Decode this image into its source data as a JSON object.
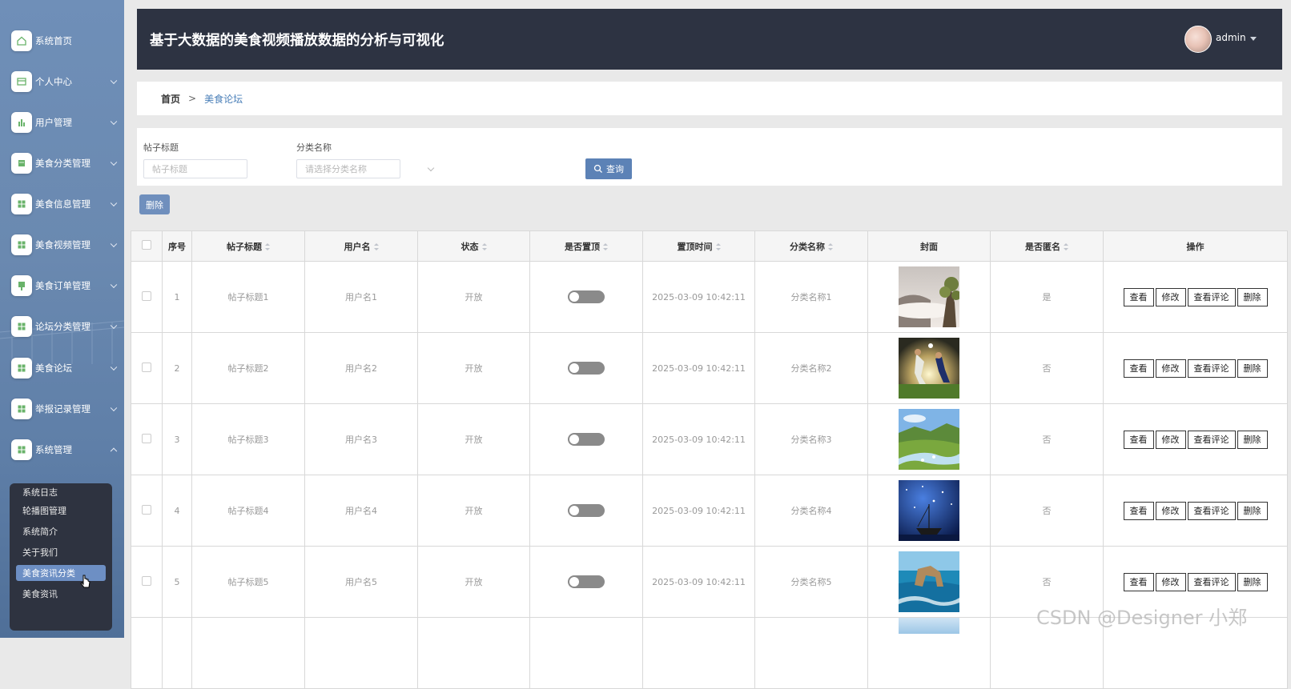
{
  "app": {
    "title": "基于大数据的美食视频播放数据的分析与可视化",
    "user": "admin"
  },
  "sidebar": {
    "items": [
      {
        "label": "系统首页",
        "icon": "home-icon"
      },
      {
        "label": "个人中心",
        "icon": "card-icon"
      },
      {
        "label": "用户管理",
        "icon": "bar-chart-icon"
      },
      {
        "label": "美食分类管理",
        "icon": "book-icon"
      },
      {
        "label": "美食信息管理",
        "icon": "grid-icon"
      },
      {
        "label": "美食视频管理",
        "icon": "grid-icon"
      },
      {
        "label": "美食订单管理",
        "icon": "pin-icon"
      },
      {
        "label": "论坛分类管理",
        "icon": "grid-icon"
      },
      {
        "label": "美食论坛",
        "icon": "grid-icon"
      },
      {
        "label": "举报记录管理",
        "icon": "grid-icon"
      },
      {
        "label": "系统管理",
        "icon": "grid-icon"
      }
    ],
    "submenu": [
      "系统日志",
      "轮播图管理",
      "系统简介",
      "关于我们",
      "美食资讯分类",
      "美食资讯"
    ],
    "submenu_active_index": 4
  },
  "breadcrumb": {
    "home": "首页",
    "separator": ">",
    "current": "美食论坛"
  },
  "search": {
    "title_label": "帖子标题",
    "title_placeholder": "帖子标题",
    "category_label": "分类名称",
    "category_placeholder": "请选择分类名称",
    "query_button": "查询"
  },
  "actions": {
    "delete_button": "删除"
  },
  "table": {
    "headers": [
      "序号",
      "帖子标题",
      "用户名",
      "状态",
      "是否置顶",
      "置顶时间",
      "分类名称",
      "封面",
      "是否匿名",
      "操作"
    ],
    "rows": [
      {
        "no": "1",
        "title": "帖子标题1",
        "user": "用户名1",
        "status": "开放",
        "time": "2025-03-09 10:42:11",
        "category": "分类名称1",
        "anon": "是",
        "cover": "misty-mountain-tree-image"
      },
      {
        "no": "2",
        "title": "帖子标题2",
        "user": "用户名2",
        "status": "开放",
        "time": "2025-03-09 10:42:11",
        "category": "分类名称2",
        "anon": "否",
        "cover": "soccer-players-image"
      },
      {
        "no": "3",
        "title": "帖子标题3",
        "user": "用户名3",
        "status": "开放",
        "time": "2025-03-09 10:42:11",
        "category": "分类名称3",
        "anon": "否",
        "cover": "green-valley-stream-image"
      },
      {
        "no": "4",
        "title": "帖子标题4",
        "user": "用户名4",
        "status": "开放",
        "time": "2025-03-09 10:42:11",
        "category": "分类名称4",
        "anon": "否",
        "cover": "starry-night-boat-image"
      },
      {
        "no": "5",
        "title": "帖子标题5",
        "user": "用户名5",
        "status": "开放",
        "time": "2025-03-09 10:42:11",
        "category": "分类名称5",
        "anon": "否",
        "cover": "sea-rock-arch-image"
      }
    ],
    "row_buttons": {
      "view": "查看",
      "edit": "修改",
      "comments": "查看评论",
      "delete": "删除"
    }
  },
  "watermark": "CSDN @Designer 小郑",
  "colors": {
    "header_bg": "#2d3342",
    "accent": "#5c82b6",
    "sidebar_top": "#6f8fb8"
  }
}
